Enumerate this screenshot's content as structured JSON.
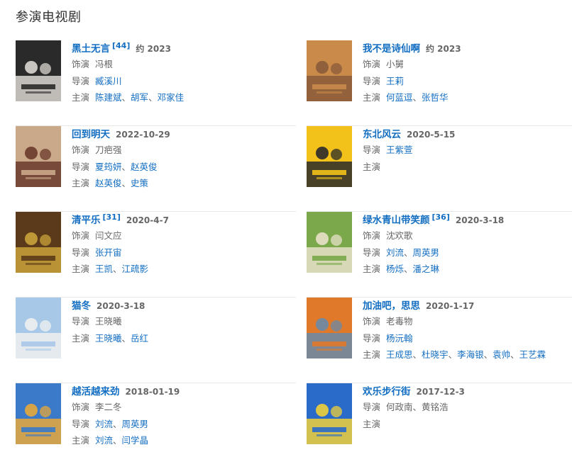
{
  "section_title": "参演电视剧",
  "labels": {
    "role": "饰演",
    "director": "导演",
    "cast": "主演"
  },
  "separator": "、",
  "items": [
    {
      "title": "黑土无言",
      "cite": "[44]",
      "date": "约 2023",
      "role": "冯根",
      "director": [
        "臧溪川"
      ],
      "cast": [
        "陈建斌",
        "胡军",
        "邓家佳"
      ],
      "poster_colors": [
        "#2a2a2a",
        "#d9d6d0"
      ]
    },
    {
      "title": "我不是诗仙啊",
      "cite": "",
      "date": "约 2023",
      "role": "小舅",
      "director": [
        "王莉"
      ],
      "cast": [
        "何蓝逗",
        "张哲华"
      ],
      "poster_colors": [
        "#c98a4a",
        "#8a5a3a"
      ]
    },
    {
      "title": "回到明天",
      "cite": "",
      "date": "2022-10-29",
      "role": "刀疤强",
      "director": [
        "夏筠妍",
        "赵英俊"
      ],
      "cast": [
        "赵英俊",
        "史策"
      ],
      "poster_colors": [
        "#caa88a",
        "#6a3a2a"
      ]
    },
    {
      "title": "东北风云",
      "cite": "",
      "date": "2020-5-15",
      "role": "",
      "director": [
        "王紫萱"
      ],
      "cast": [],
      "poster_colors": [
        "#f2c21a",
        "#2a2a2a"
      ]
    },
    {
      "title": "清平乐",
      "cite": "[31]",
      "date": "2020-4-7",
      "role": "闫文应",
      "director": [
        "张开宙"
      ],
      "cast": [
        "王凯",
        "江疏影"
      ],
      "poster_colors": [
        "#5a3a1a",
        "#c9a23a"
      ]
    },
    {
      "title": "绿水青山带笑颜",
      "cite": "[36]",
      "date": "2020-3-18",
      "role": "沈欢歌",
      "director": [
        "刘流",
        "周英男"
      ],
      "cast": [
        "杨烁",
        "潘之琳"
      ],
      "poster_colors": [
        "#7aa84a",
        "#e8e0c8"
      ]
    },
    {
      "title": "猫冬",
      "cite": "",
      "date": "2020-3-18",
      "role": "",
      "director_plain": "王晓曦",
      "director": [],
      "cast": [
        "王晓曦",
        "岳红"
      ],
      "poster_colors": [
        "#a8c8e8",
        "#f0f0f0"
      ]
    },
    {
      "title": "加油吧，思思",
      "cite": "",
      "date": "2020-1-17",
      "role": "老毒物",
      "director": [
        "杨沅翰"
      ],
      "cast": [
        "王成思",
        "杜晓宇",
        "李海银",
        "袁帅",
        "王艺霖"
      ],
      "poster_colors": [
        "#e07a2a",
        "#6a8aa8"
      ]
    },
    {
      "title": "越活越来劲",
      "cite": "",
      "date": "2018-01-19",
      "role": "李二冬",
      "director": [
        "刘流",
        "周英男"
      ],
      "cast": [
        "刘流",
        "闫学晶"
      ],
      "poster_colors": [
        "#3a7ac8",
        "#e8a83a"
      ]
    },
    {
      "title": "欢乐步行街",
      "cite": "",
      "date": "2017-12-3",
      "role": "",
      "director_plain": "何政南、黄铭浩",
      "director": [],
      "cast": [],
      "poster_colors": [
        "#2a6ac8",
        "#f0d03a"
      ]
    }
  ]
}
